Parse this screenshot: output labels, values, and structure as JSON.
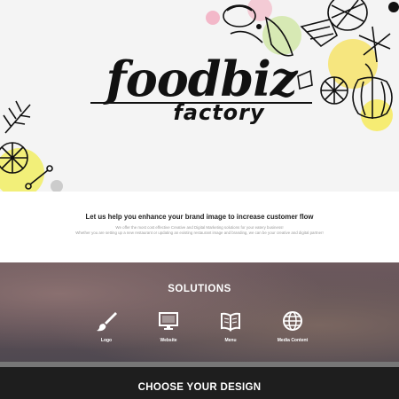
{
  "hero": {
    "logo_main": "foodbiz",
    "logo_sub": "factory"
  },
  "intro": {
    "headline": "Let us help you enhance your brand image to increase customer flow",
    "line1": "We offer the most cost effective Creative and Digital Marketing solutions for your eatery business!",
    "line2": "Whether you are setting up a new restaurant or updating an existing restaurant image and branding, we can be your creative and digital partner!"
  },
  "solutions": {
    "title": "SOLUTIONS",
    "items": [
      {
        "label": "Logo",
        "icon": "brush-icon"
      },
      {
        "label": "Website",
        "icon": "monitor-icon"
      },
      {
        "label": "Menu",
        "icon": "book-icon"
      },
      {
        "label": "Media Content",
        "icon": "globe-icon"
      }
    ]
  },
  "choose": {
    "title": "CHOOSE YOUR DESIGN"
  }
}
